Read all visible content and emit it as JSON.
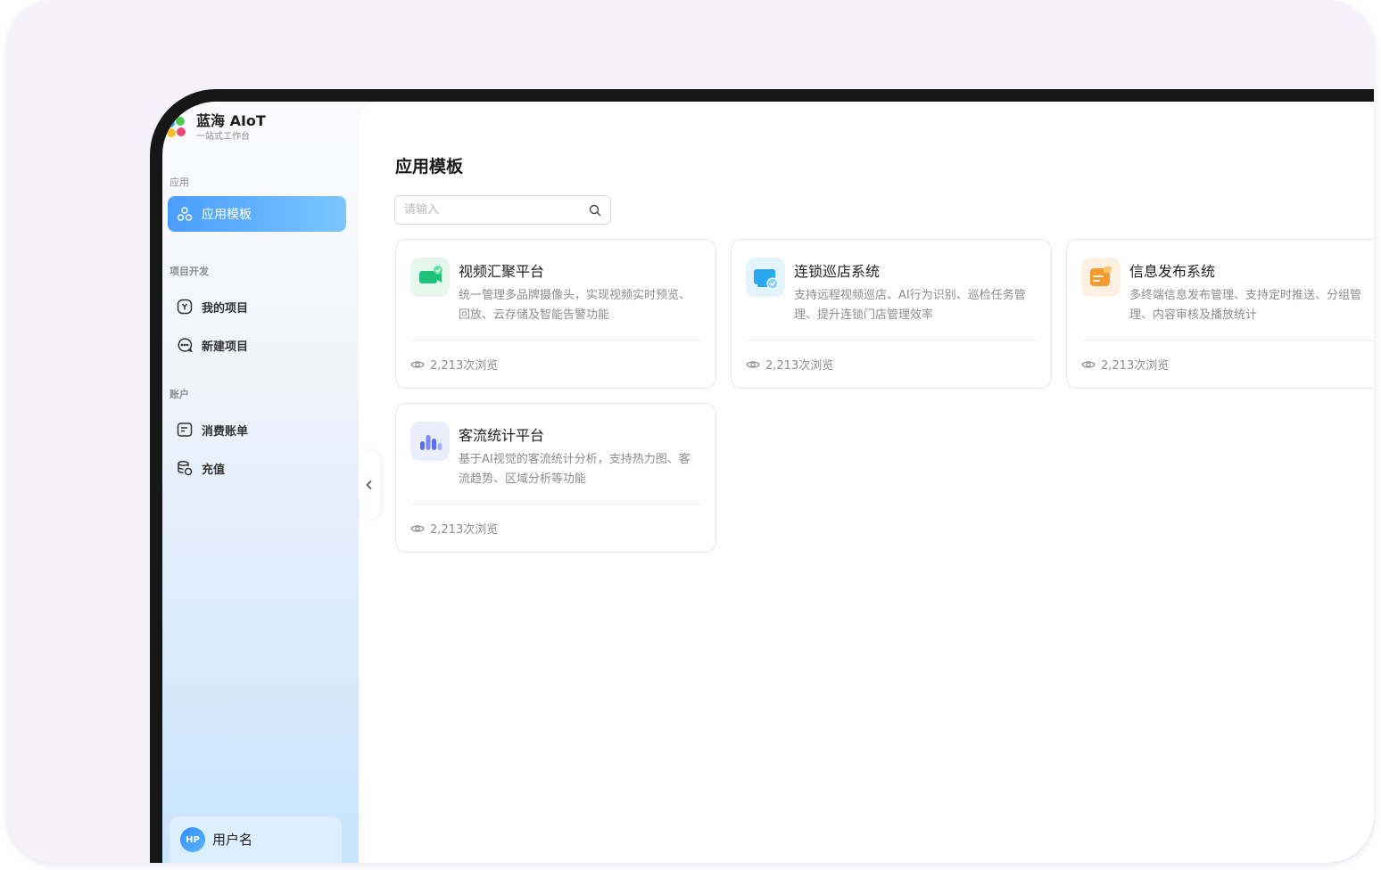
{
  "brand": {
    "title": "蓝海 AIoT",
    "subtitle": "一站式工作台"
  },
  "sidebar": {
    "section_app": "应用",
    "active_item": "应用模板",
    "section_project": "项目开发",
    "project_items": [
      "我的项目",
      "新建项目"
    ],
    "section_account": "账户",
    "account_items": [
      "消费账单",
      "充值"
    ]
  },
  "user": {
    "avatar_initials": "HP",
    "name": "用户名"
  },
  "main": {
    "title": "应用模板",
    "search_placeholder": "请输入",
    "cards": [
      {
        "title": "视频汇聚平台",
        "desc": "统一管理多品牌摄像头，实现视频实时预览、回放、云存储及智能告警功能",
        "views": "2,213次浏览",
        "icon": "video-camera-icon",
        "color": "#22c47a"
      },
      {
        "title": "连锁巡店系统",
        "desc": "支持远程视频巡店、AI行为识别、巡检任务管理、提升连锁门店管理效率",
        "views": "2,213次浏览",
        "icon": "store-check-icon",
        "color": "#38b6f4"
      },
      {
        "title": "信息发布系统",
        "desc": "多终端信息发布管理、支持定时推送、分组管理、内容审核及播放统计",
        "views": "2,213次浏览",
        "icon": "info-publish-icon",
        "color": "#f5a23c"
      },
      {
        "title": "客流统计平台",
        "desc": "基于AI视觉的客流统计分析，支持热力图、客流趋势、区域分析等功能",
        "views": "2,213次浏览",
        "icon": "bar-chart-icon",
        "color": "#6b7ff0"
      }
    ]
  }
}
